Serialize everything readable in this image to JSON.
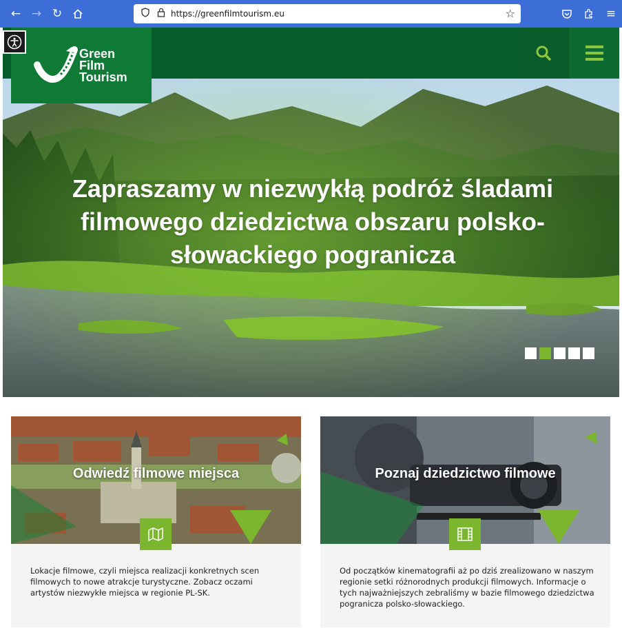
{
  "browser": {
    "url": "https://greenfilmtourism.eu"
  },
  "site": {
    "logo_lines": [
      "Green",
      "Film",
      "Tourism"
    ]
  },
  "hero": {
    "title": "Zapraszamy w niezwykłą podróż śladami filmowego dziedzictwa obszaru polsko-słowackiego pogranicza",
    "slides_total": 5,
    "active_slide": 2
  },
  "cards": [
    {
      "title": "Odwiedź filmowe miejsca",
      "text": "Lokacje filmowe, czyli miejsca realizacji konkretnych scen filmowych to nowe atrakcje turystyczne. Zobacz oczami artystów niezwykłe miejsca w regionie PL-SK.",
      "icon": "map-icon"
    },
    {
      "title": "Poznaj dziedzictwo filmowe",
      "text": "Od początków kinematografii aż po dziś zrealizowano w naszym regionie setki różnorodnych produkcji filmowych. Informacje o tych najważniejszych zebraliśmy w bazie filmowego dziedzictwa pogranicza polsko-słowackiego.",
      "icon": "film-icon"
    }
  ],
  "colors": {
    "brand_dark": "#065c2b",
    "brand_green": "#0e7a35",
    "accent_lime": "#7cb52e",
    "browser_blue": "#3d6ed8"
  }
}
